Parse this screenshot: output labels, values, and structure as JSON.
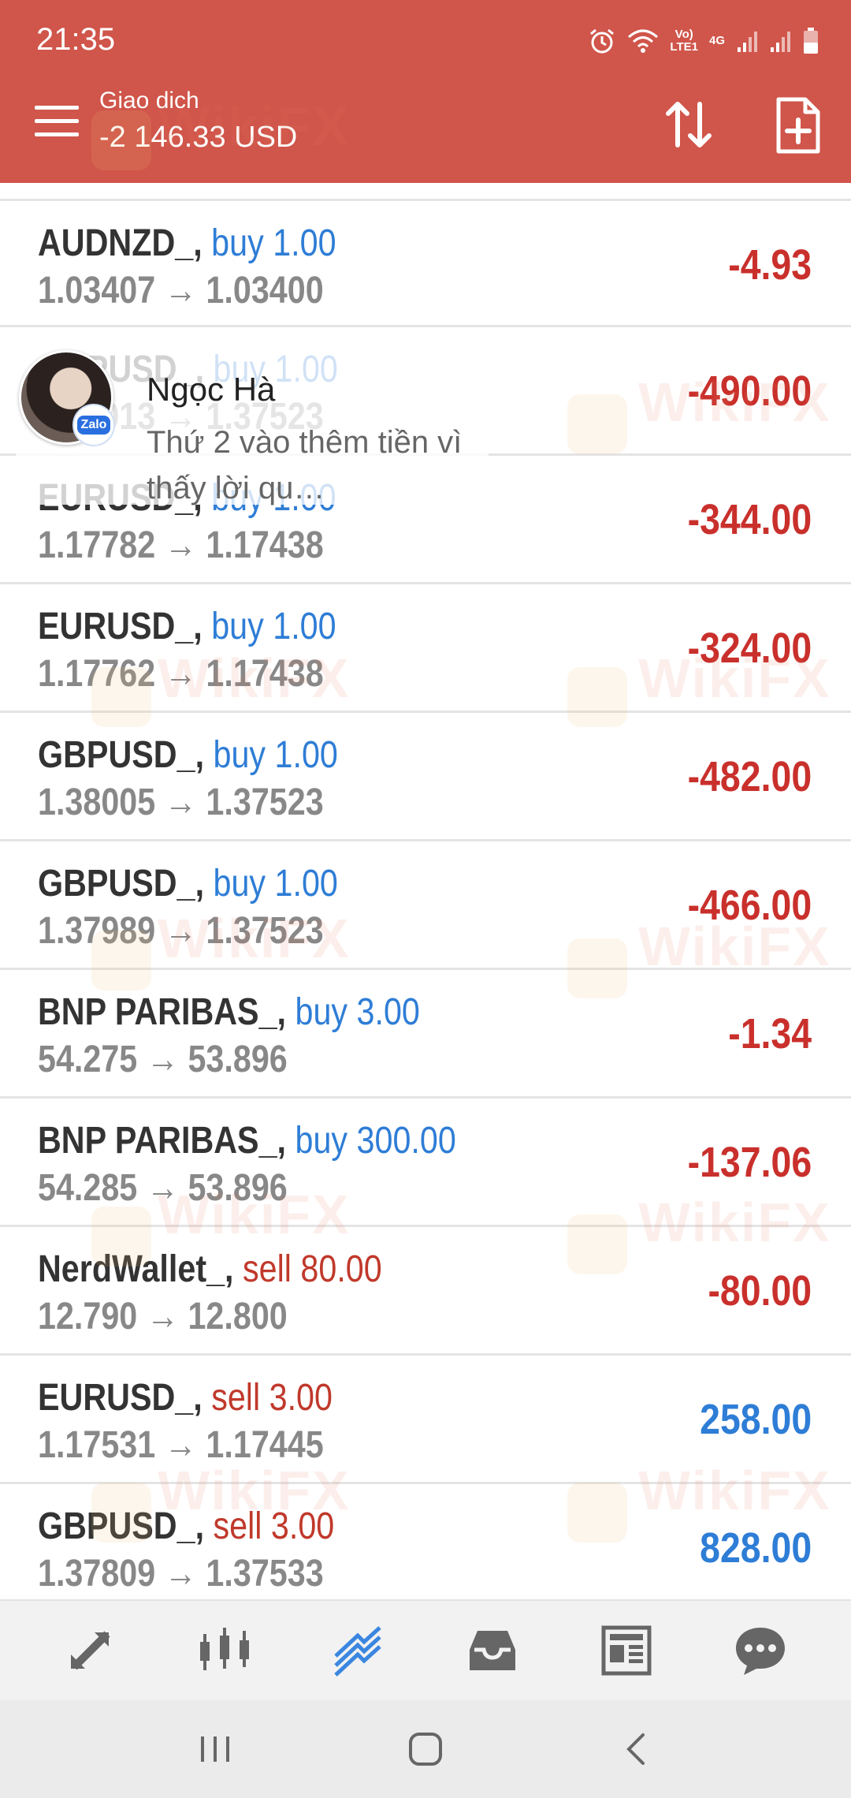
{
  "status_bar": {
    "time": "21:35",
    "volte_top": "Vo)",
    "volte_bottom": "LTE1",
    "network": "4G"
  },
  "app_bar": {
    "subtitle": "Giao dich",
    "balance": "-2 146.33 USD"
  },
  "watermark": "WikiFX",
  "trades": [
    {
      "symbol": "AUDNZD_,",
      "side": "buy 1.00",
      "side_type": "buy",
      "prices": "1.03407 → 1.03400",
      "profit": "-4.93",
      "sign": "neg"
    },
    {
      "symbol": "GBPUSD_,",
      "side": "buy 1.00",
      "side_type": "buy",
      "prices": "1.38013 → 1.37523",
      "profit": "-490.00",
      "sign": "neg"
    },
    {
      "symbol": "EURUSD_,",
      "side": "buy 1.00",
      "side_type": "buy",
      "prices": "1.17782 → 1.17438",
      "profit": "-344.00",
      "sign": "neg"
    },
    {
      "symbol": "EURUSD_,",
      "side": "buy 1.00",
      "side_type": "buy",
      "prices": "1.17762 → 1.17438",
      "profit": "-324.00",
      "sign": "neg"
    },
    {
      "symbol": "GBPUSD_,",
      "side": "buy 1.00",
      "side_type": "buy",
      "prices": "1.38005 → 1.37523",
      "profit": "-482.00",
      "sign": "neg"
    },
    {
      "symbol": "GBPUSD_,",
      "side": "buy 1.00",
      "side_type": "buy",
      "prices": "1.37989 → 1.37523",
      "profit": "-466.00",
      "sign": "neg"
    },
    {
      "symbol": "BNP PARIBAS_,",
      "side": "buy 3.00",
      "side_type": "buy",
      "prices": "54.275 → 53.896",
      "profit": "-1.34",
      "sign": "neg"
    },
    {
      "symbol": "BNP PARIBAS_,",
      "side": "buy 300.00",
      "side_type": "buy",
      "prices": "54.285 → 53.896",
      "profit": "-137.06",
      "sign": "neg"
    },
    {
      "symbol": "NerdWallet_,",
      "side": "sell 80.00",
      "side_type": "sell",
      "prices": "12.790 → 12.800",
      "profit": "-80.00",
      "sign": "neg"
    },
    {
      "symbol": "EURUSD_,",
      "side": "sell 3.00",
      "side_type": "sell",
      "prices": "1.17531 → 1.17445",
      "profit": "258.00",
      "sign": "pos"
    },
    {
      "symbol": "GBPUSD_,",
      "side": "sell 3.00",
      "side_type": "sell",
      "prices": "1.37809 → 1.37533",
      "profit": "828.00",
      "sign": "pos"
    }
  ],
  "notification": {
    "app": "Zalo",
    "sender": "Ngọc Hà",
    "message": "Thứ 2 vào thêm tiền vì thấy lời qu…"
  },
  "bottom_nav": [
    "quotes-icon",
    "chart-icon",
    "trade-icon",
    "history-icon",
    "news-icon",
    "chat-icon"
  ],
  "colors": {
    "header": "#d0554a",
    "buy": "#2e7dd6",
    "sell": "#c0392b",
    "loss": "#c9302c",
    "gain": "#2e7dd6",
    "active_nav": "#3a86e0"
  }
}
